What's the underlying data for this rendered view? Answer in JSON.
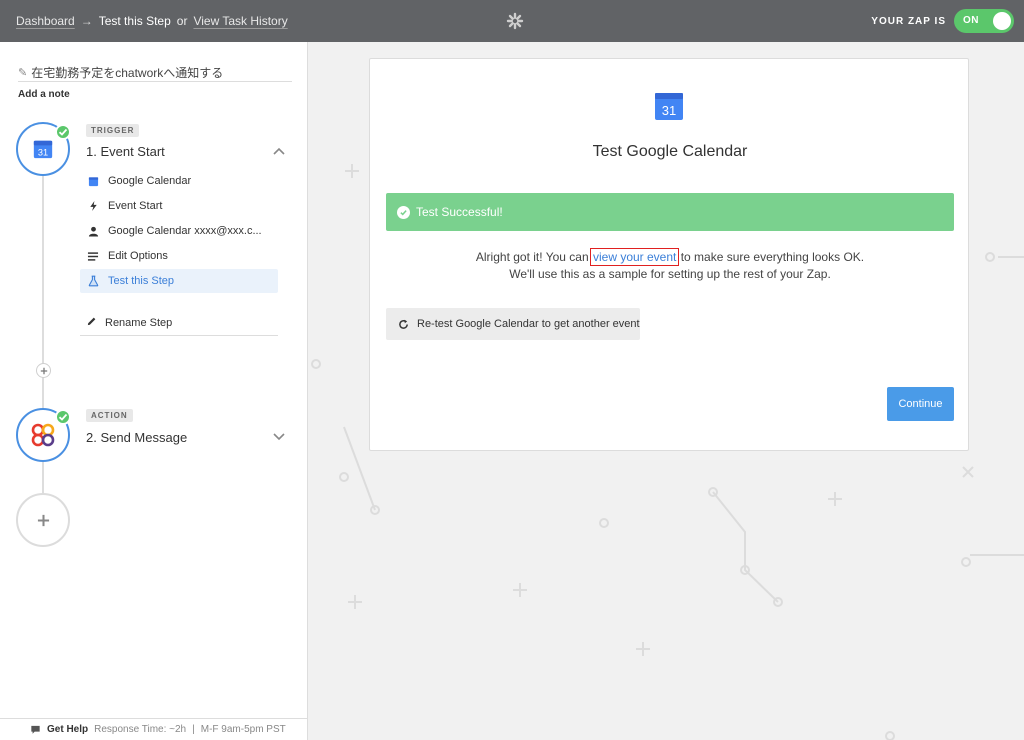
{
  "topbar": {
    "dashboard_label": "Dashboard",
    "arrow": "→",
    "current_label": "Test this Step",
    "or_label": "or",
    "history_label": "View Task History",
    "zap_status_label": "YOUR ZAP IS",
    "toggle_label": "ON"
  },
  "sidebar": {
    "zap_name": "在宅勤務予定をchatworkへ通知する",
    "add_note": "Add a note",
    "trigger": {
      "tag": "TRIGGER",
      "title": "1. Event Start",
      "substeps": [
        {
          "label": "Google Calendar",
          "icon": "google-calendar-icon"
        },
        {
          "label": "Event Start",
          "icon": "lightning-icon"
        },
        {
          "label": "Google Calendar xxxx@xxx.c...",
          "icon": "user-icon"
        },
        {
          "label": "Edit Options",
          "icon": "lines-icon"
        },
        {
          "label": "Test this Step",
          "icon": "flask-icon",
          "active": true
        }
      ],
      "rename": "Rename Step"
    },
    "action": {
      "tag": "ACTION",
      "title": "2. Send Message"
    },
    "help": {
      "label": "Get Help",
      "response": "Response Time: ~2h",
      "sep": "|",
      "hours": "M-F 9am-5pm PST"
    }
  },
  "card": {
    "calendar_day": "31",
    "title": "Test Google Calendar",
    "banner": "Test Successful!",
    "msg_pre": "Alright got it! You can ",
    "msg_link": "view your event",
    "msg_post": " to make sure everything looks OK.",
    "msg_line2": "We'll use this as a sample for setting up the rest of your Zap.",
    "retest_label": "Re-test Google Calendar to get another event",
    "continue_label": "Continue"
  },
  "colors": {
    "topbar": "#616366",
    "toggle_on": "#5bc76b",
    "success_banner": "#7ad18e",
    "continue_button": "#4a9be8",
    "link": "#3b7fd8",
    "highlight_box": "#e02020"
  }
}
